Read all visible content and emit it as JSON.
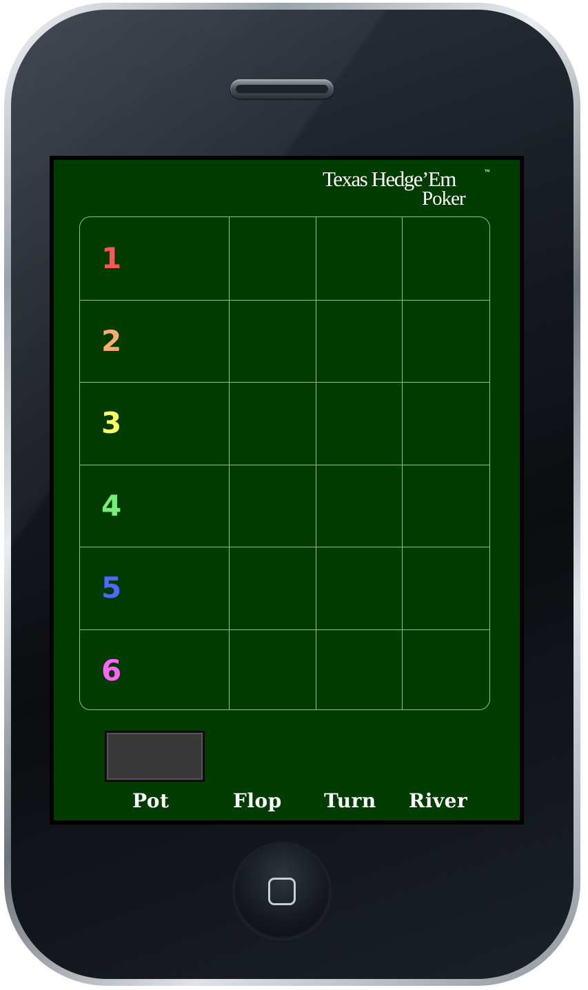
{
  "app": {
    "logo_line1": "Texas Hedge’Em",
    "logo_tm": "™",
    "logo_line2": "Poker"
  },
  "hands": [
    {
      "number": "1",
      "color": "#ff5555"
    },
    {
      "number": "2",
      "color": "#ffaa70"
    },
    {
      "number": "3",
      "color": "#ffff66"
    },
    {
      "number": "4",
      "color": "#77ee77"
    },
    {
      "number": "5",
      "color": "#5566ff"
    },
    {
      "number": "6",
      "color": "#ff66ff"
    }
  ],
  "labels": {
    "pot": "Pot",
    "flop": "Flop",
    "turn": "Turn",
    "river": "River"
  },
  "colors": {
    "felt": "#003c00",
    "grid_line": "#9ab89a",
    "pot_box": "#383838"
  },
  "icons": {
    "speaker": "speaker-grille-icon",
    "home": "home-button-icon"
  }
}
